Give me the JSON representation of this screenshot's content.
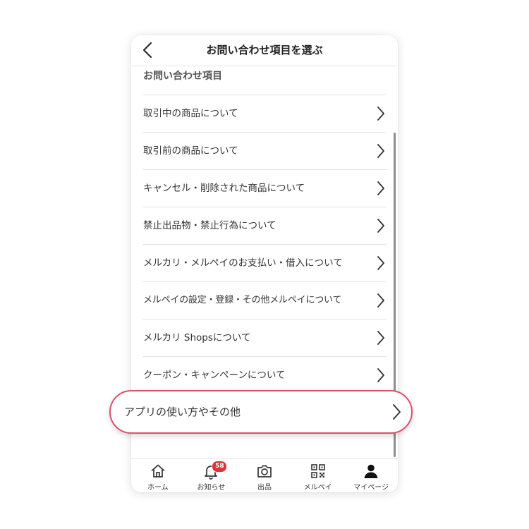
{
  "header": {
    "title": "お問い合わせ項目を選ぶ"
  },
  "section": {
    "title": "お問い合わせ項目"
  },
  "items": [
    {
      "label": "取引中の商品について"
    },
    {
      "label": "取引前の商品について"
    },
    {
      "label": "キャンセル・削除された商品について"
    },
    {
      "label": "禁止出品物・禁止行為について"
    },
    {
      "label": "メルカリ・メルペイのお支払い・借入について"
    },
    {
      "label": "メルペイの設定・登録・その他メルペイについて"
    },
    {
      "label": "メルカリ Shopsについて"
    },
    {
      "label": "クーポン・キャンペーンについて"
    }
  ],
  "highlighted_item": {
    "label": "アプリの使い方やその他"
  },
  "tabbar": {
    "tabs": [
      {
        "label": "ホーム",
        "icon": "home-icon"
      },
      {
        "label": "お知らせ",
        "icon": "bell-icon",
        "badge": "58"
      },
      {
        "label": "出品",
        "icon": "camera-icon"
      },
      {
        "label": "メルペイ",
        "icon": "qr-code-icon"
      },
      {
        "label": "マイページ",
        "icon": "person-icon"
      }
    ]
  },
  "colors": {
    "highlight_border": "#d9526a",
    "badge": "#e0323a",
    "text": "#333333"
  }
}
